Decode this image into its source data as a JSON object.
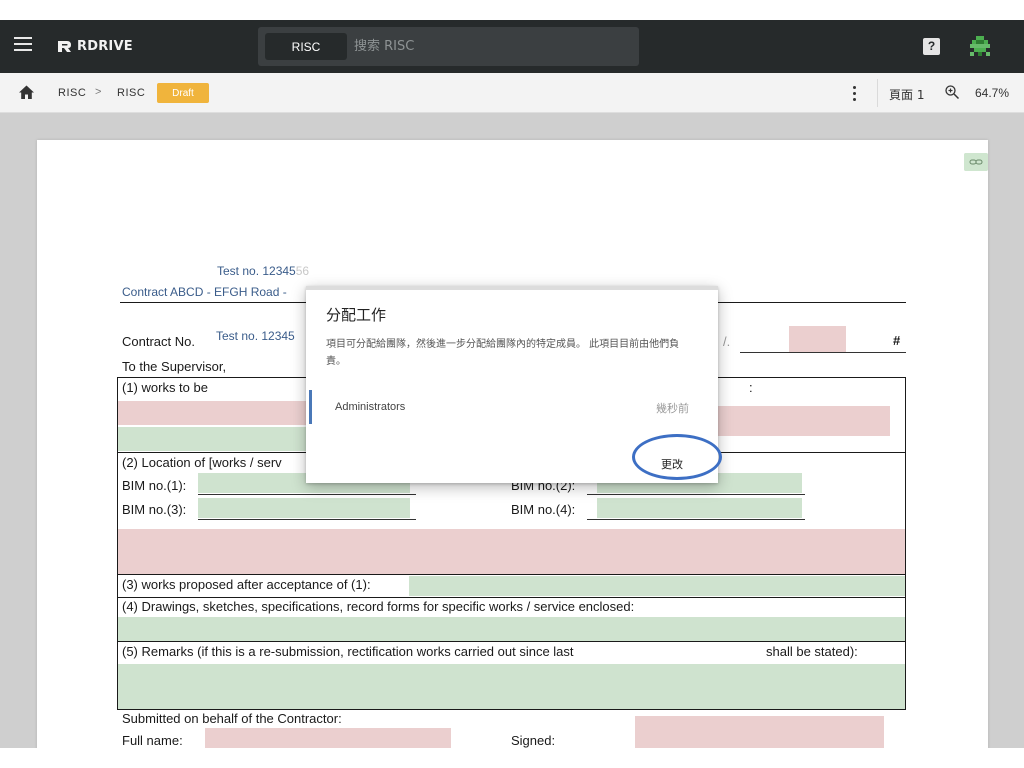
{
  "appbar": {
    "logo_text": "RDRIVE",
    "search_scope": "RISC",
    "search_placeholder": "搜索 RISC",
    "help_label": "?"
  },
  "breadcrumb": {
    "crumb_1": "RISC",
    "separator": ">",
    "crumb_2": "RISC",
    "status_badge": "Draft",
    "page_label": "頁面 1",
    "zoom_value": "64.7%"
  },
  "document": {
    "test_no_1": "Test no. 1234556",
    "test_no_1_main": "Test no. 12345",
    "test_no_1_fade": "56",
    "contract_header": "Contract ABCD - EFGH Road -",
    "contract_no_label": "Contract No.",
    "test_no_2": "Test no. 12345",
    "trailing_dot": "/.",
    "hash": "#",
    "to_supervisor": "To the Supervisor,",
    "works_to_be": "(1) works to be",
    "colon": ":",
    "location": "(2) Location of [works / serv",
    "bim1": "BIM no.(1):",
    "bim2": "BIM no.(2):",
    "bim3": "BIM no.(3):",
    "bim4": "BIM no.(4):",
    "works_proposed": "(3) works proposed after acceptance of (1):",
    "drawings": "(4) Drawings, sketches, specifications, record forms for specific works / service enclosed:",
    "remarks": "(5) Remarks (if this is a re-submission, rectification works carried out since last",
    "remarks_end": "shall be stated):",
    "submitted": "Submitted on behalf of the Contractor:",
    "full_name": "Full name:",
    "signed": "Signed:"
  },
  "dialog": {
    "title": "分配工作",
    "description": "項目可分配給團隊，然後進一步分配給團隊內的特定成員。 此項目目前由他們負責。",
    "assignee_name": "Administrators",
    "assignee_time": "幾秒前",
    "change_button": "更改"
  },
  "colors": {
    "appbar_bg": "#262a2b",
    "badge": "#f0b43c",
    "annotation_circle": "#3d6fc4",
    "assignee_accent": "#4a78b8"
  },
  "icons": {
    "menu": "hamburger-menu-icon",
    "logo": "rdrive-logo-icon",
    "help": "help-icon",
    "avatar": "pixel-avatar-icon",
    "home": "home-icon",
    "more": "more-vertical-icon",
    "zoom": "zoom-icon",
    "link": "link-icon"
  }
}
